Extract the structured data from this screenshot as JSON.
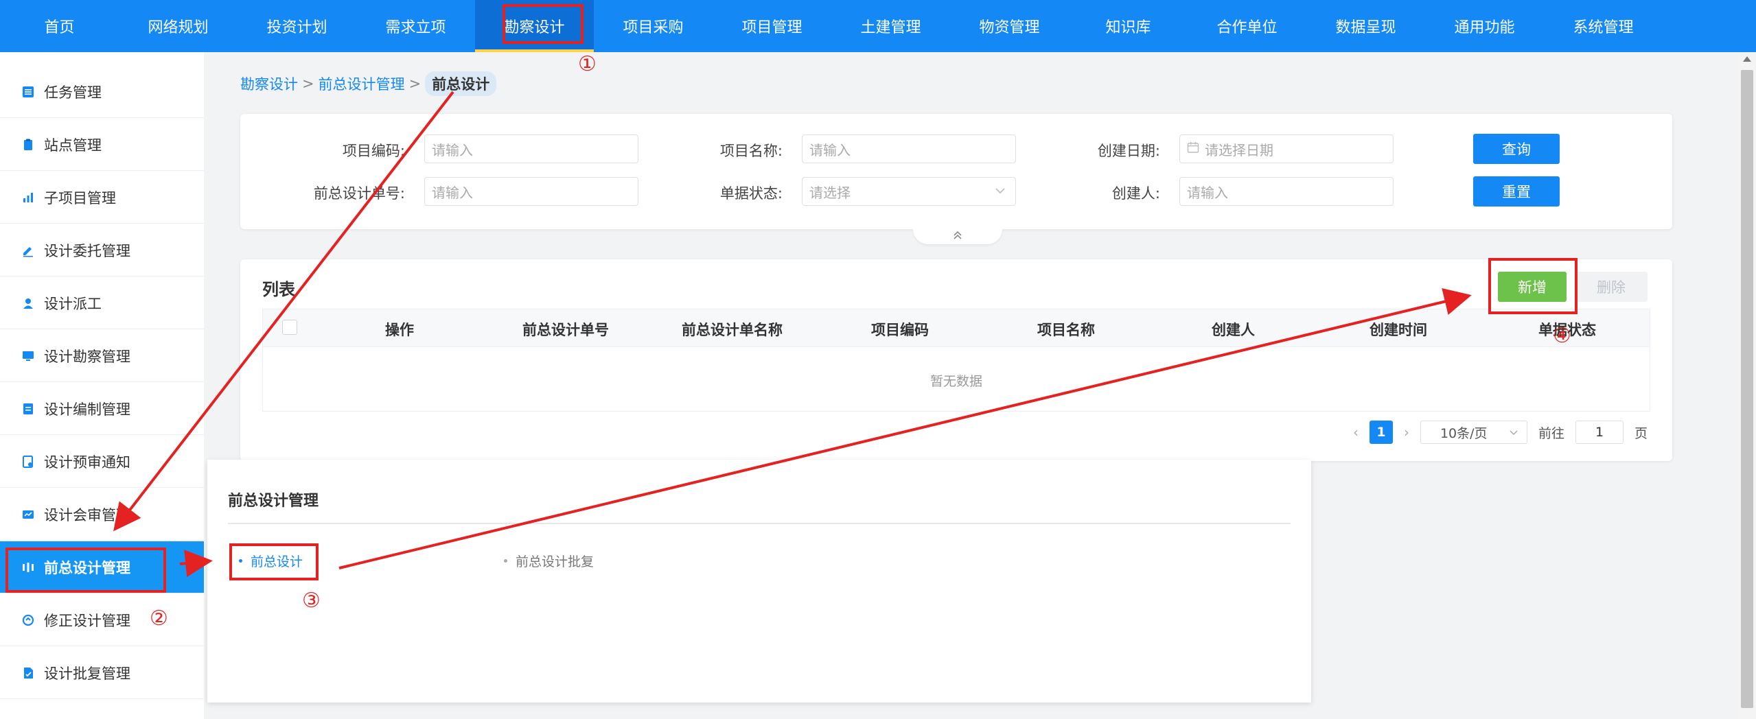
{
  "topnav": {
    "items": [
      "首页",
      "网络规划",
      "投资计划",
      "需求立项",
      "勘察设计",
      "项目采购",
      "项目管理",
      "土建管理",
      "物资管理",
      "知识库",
      "合作单位",
      "数据呈现",
      "通用功能",
      "系统管理"
    ],
    "active": "勘察设计",
    "color": "#1488f5"
  },
  "sidebar": {
    "items": [
      {
        "label": "任务管理",
        "icon": "list-icon"
      },
      {
        "label": "站点管理",
        "icon": "clipboard-icon"
      },
      {
        "label": "子项目管理",
        "icon": "bar-chart-icon"
      },
      {
        "label": "设计委托管理",
        "icon": "edit-icon"
      },
      {
        "label": "设计派工",
        "icon": "user-icon"
      },
      {
        "label": "设计勘察管理",
        "icon": "monitor-icon"
      },
      {
        "label": "设计编制管理",
        "icon": "document-icon"
      },
      {
        "label": "设计预审通知",
        "icon": "notice-icon"
      },
      {
        "label": "设计会审管理",
        "icon": "review-icon"
      },
      {
        "label": "前总设计管理",
        "icon": "design-icon"
      },
      {
        "label": "修正设计管理",
        "icon": "revise-icon"
      },
      {
        "label": "设计批复管理",
        "icon": "approve-icon"
      }
    ],
    "active": "前总设计管理",
    "active_color": "#1596f5"
  },
  "breadcrumb": {
    "level1": "勘察设计",
    "level2": "前总设计管理",
    "current": "前总设计",
    "sep": ">"
  },
  "filter": {
    "project_code_label": "项目编码:",
    "project_code_placeholder": "请输入",
    "project_name_label": "项目名称:",
    "project_name_placeholder": "请输入",
    "create_date_label": "创建日期:",
    "create_date_placeholder": "请选择日期",
    "design_no_label": "前总设计单号:",
    "design_no_placeholder": "请输入",
    "status_label": "单据状态:",
    "status_placeholder": "请选择",
    "creator_label": "创建人:",
    "creator_placeholder": "请输入",
    "query_button": "查询",
    "reset_button": "重置"
  },
  "list": {
    "title": "列表",
    "add_button": "新增",
    "delete_button": "删除",
    "columns": [
      "操作",
      "前总设计单号",
      "前总设计单名称",
      "项目编码",
      "项目名称",
      "创建人",
      "创建时间",
      "单据状态"
    ],
    "empty_text": "暂无数据"
  },
  "pagination": {
    "current_page": "1",
    "page_size": "10条/页",
    "goto_label": "前往",
    "goto_value": "1",
    "page_unit": "页"
  },
  "flyout": {
    "title": "前总设计管理",
    "items": [
      "前总设计",
      "前总设计批复"
    ]
  },
  "annotations": {
    "step1": "①",
    "step2": "②",
    "step3": "③",
    "step4": "④",
    "color": "#e52222"
  }
}
